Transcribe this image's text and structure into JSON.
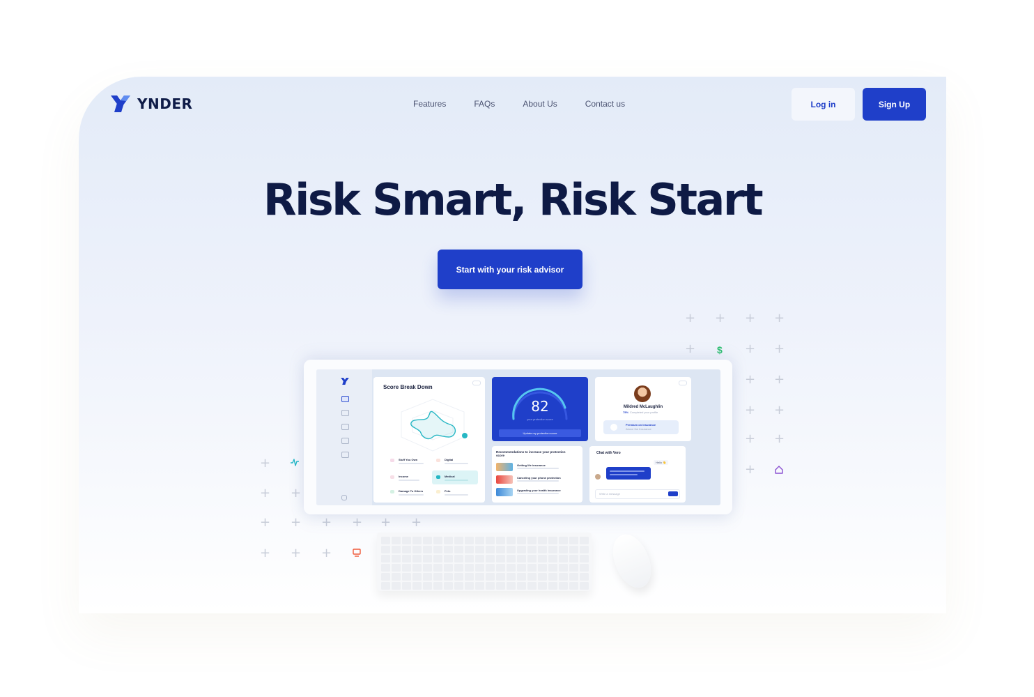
{
  "brand": {
    "name": "YNDER",
    "primary_color": "#1f3fc9",
    "ink_color": "#0e1a45"
  },
  "nav": {
    "links": [
      {
        "label": "Features"
      },
      {
        "label": "FAQs"
      },
      {
        "label": "About Us"
      },
      {
        "label": "Contact us"
      }
    ],
    "login_label": "Log in",
    "signup_label": "Sign Up"
  },
  "hero": {
    "title": "Risk Smart, Risk Start",
    "cta_label": "Start with your risk advisor"
  },
  "dashboard": {
    "score_breakdown_title": "Score Break Down",
    "score": "82",
    "score_caption": "your protection score",
    "update_button": "Update my protection score",
    "profile_name": "Mildred McLaughlin",
    "profile_progress": "75%",
    "profile_progress_caption": "Completed your profile",
    "premium_label": "Premium on Insurance",
    "premium_sub": "Above the Insurance",
    "categories": [
      {
        "label": "Stuff You Own",
        "color": "#ec7fb6"
      },
      {
        "label": "Digital",
        "color": "#f19a8a"
      },
      {
        "label": "Income",
        "color": "#e88aa8"
      },
      {
        "label": "Medical",
        "color": "#26b7c4"
      },
      {
        "label": "Damage To Others",
        "color": "#43c08a"
      },
      {
        "label": "Pets",
        "color": "#f2c14b"
      }
    ],
    "recommendations_title": "Recommendations to increase your protection score",
    "recommendations": [
      {
        "label": "Getting life insurance"
      },
      {
        "label": "Canceling your phone protection"
      },
      {
        "label": "Upgrading your health insurance"
      }
    ],
    "chat_title": "Chat with Vero",
    "chat_hello": "Hello 👋",
    "chat_placeholder": "Write a message"
  },
  "icons": [
    {
      "name": "ynder-logo-icon"
    },
    {
      "name": "dollar-icon",
      "color": "#2fbf71"
    },
    {
      "name": "activity-icon",
      "color": "#22b8c7"
    },
    {
      "name": "home-icon",
      "color": "#8a4fd1"
    },
    {
      "name": "monitor-icon",
      "color": "#f05a3a"
    }
  ]
}
